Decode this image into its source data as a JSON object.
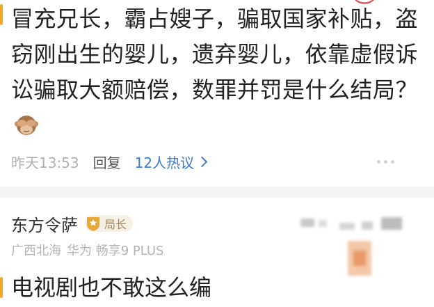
{
  "top_comment": {
    "text": "冒充兄长，霸占嫂子，骗取国家补贴，盗窃刚出生的婴儿，遗弃婴儿，依靠虚假诉讼骗取大额赔偿，数罪并罚是什么结局？",
    "emoji": "see-no-evil-monkey",
    "time": "昨天13:53",
    "reply_label": "回复",
    "hot_discuss_label": "12人热议"
  },
  "second_comment": {
    "username": "东方令萨",
    "level_label": "局长",
    "location": "广西北海",
    "device": "华为 畅享9 PLUS",
    "text": "电视剧也不敢这么编"
  },
  "colors": {
    "accent_link": "#3a7bd5",
    "quote_bar": "#f5a623",
    "badge_bg": "#f6f1e6",
    "badge_icon": "#e8a93a"
  }
}
